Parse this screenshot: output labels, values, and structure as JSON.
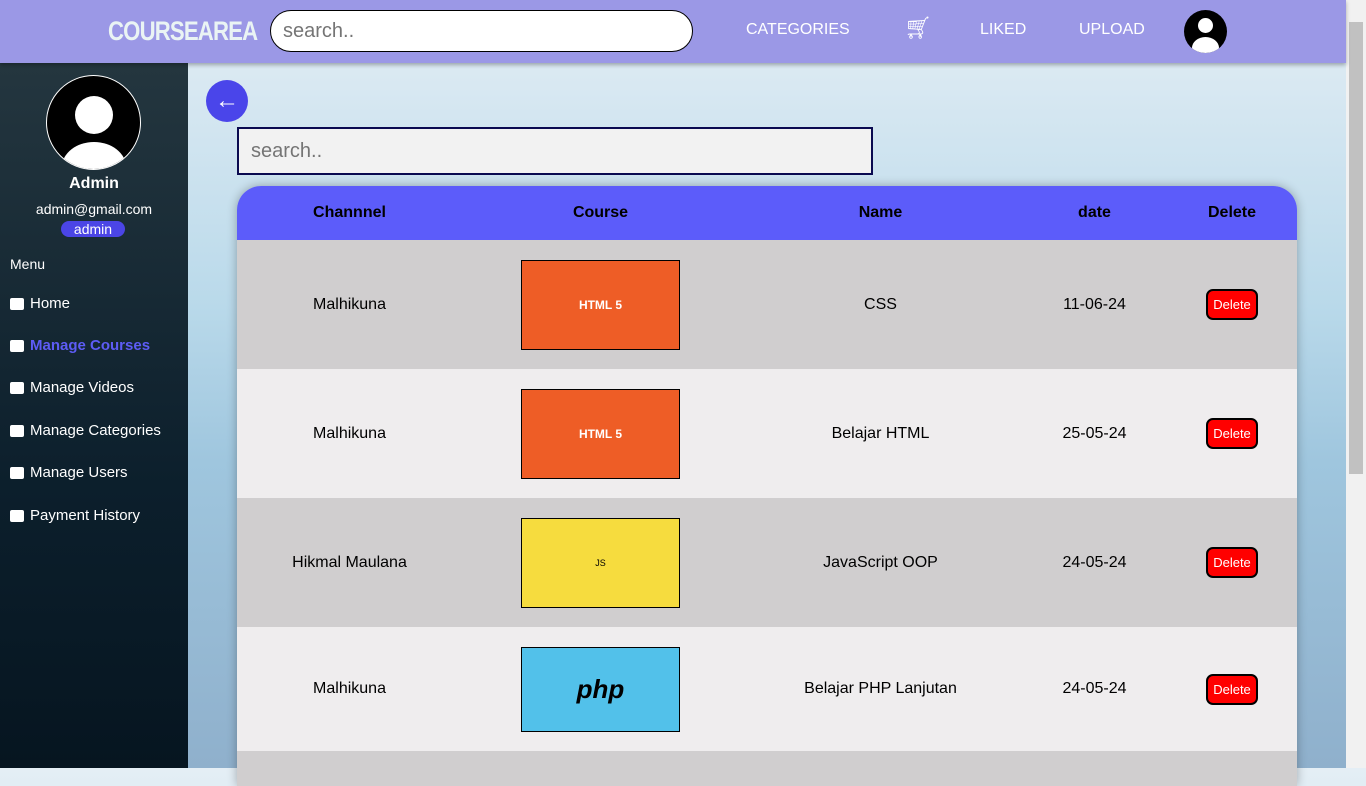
{
  "header": {
    "logo": "COURSEAREA",
    "search_placeholder": "search..",
    "nav": [
      "CATEGORIES",
      "LIKED",
      "UPLOAD"
    ]
  },
  "sidebar": {
    "name": "Admin",
    "email": "admin@gmail.com",
    "role": "admin",
    "menu_title": "Menu",
    "items": [
      {
        "label": "Home",
        "icon": "home-icon"
      },
      {
        "label": "Manage Courses",
        "icon": "monitor-icon",
        "active": true
      },
      {
        "label": "Manage Videos",
        "icon": "play-icon"
      },
      {
        "label": "Manage Categories",
        "icon": "layers-icon"
      },
      {
        "label": "Manage Users",
        "icon": "user-card-icon"
      },
      {
        "label": "Payment History",
        "icon": "credit-card-icon"
      }
    ]
  },
  "main": {
    "search_placeholder": "search..",
    "columns": [
      "Channnel",
      "Course",
      "Name",
      "date",
      "Delete"
    ],
    "rows": [
      {
        "channel": "Malhikuna",
        "thumb": "HTML 5",
        "thumb_color": "#ee5d26",
        "name": "CSS",
        "date": "11-06-24",
        "delete": "Delete"
      },
      {
        "channel": "Malhikuna",
        "thumb": "HTML 5",
        "thumb_color": "#ee5d26",
        "name": "Belajar HTML",
        "date": "25-05-24",
        "delete": "Delete"
      },
      {
        "channel": "Hikmal Maulana",
        "thumb": "JS",
        "thumb_color": "#f6dc3e",
        "name": "JavaScript OOP",
        "date": "24-05-24",
        "delete": "Delete"
      },
      {
        "channel": "Malhikuna",
        "thumb": "php",
        "thumb_color": "#52c1ea",
        "name": "Belajar PHP Lanjutan",
        "date": "24-05-24",
        "delete": "Delete"
      }
    ]
  }
}
